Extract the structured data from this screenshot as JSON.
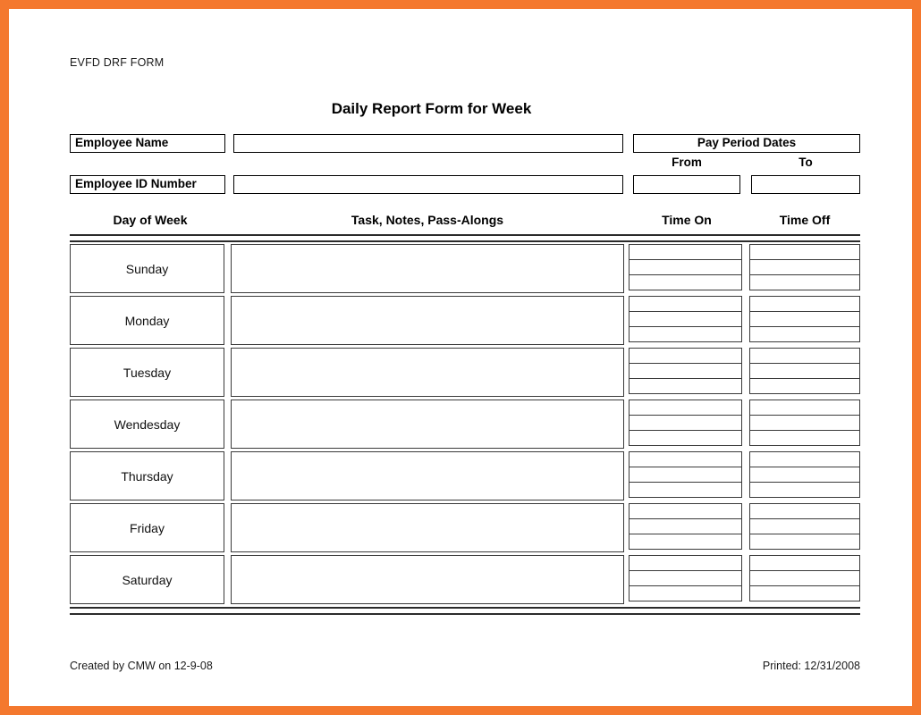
{
  "page": {
    "border_color": "#f4782e",
    "background": "#ffffff",
    "form_code": "EVFD DRF FORM",
    "title": "Daily Report Form for Week"
  },
  "employee": {
    "name_label": "Employee Name",
    "name_value": "",
    "id_label": "Employee ID Number",
    "id_value": ""
  },
  "pay_period": {
    "heading": "Pay Period Dates",
    "from_label": "From",
    "from_value": "",
    "to_label": "To",
    "to_value": ""
  },
  "table": {
    "headers": {
      "day": "Day of Week",
      "task": "Task, Notes, Pass-Alongs",
      "time_on": "Time On",
      "time_off": "Time Off"
    },
    "rows": [
      {
        "day": "Sunday",
        "task": "",
        "time_on": [
          "",
          "",
          ""
        ],
        "time_off": [
          "",
          "",
          ""
        ]
      },
      {
        "day": "Monday",
        "task": "",
        "time_on": [
          "",
          "",
          ""
        ],
        "time_off": [
          "",
          "",
          ""
        ]
      },
      {
        "day": "Tuesday",
        "task": "",
        "time_on": [
          "",
          "",
          ""
        ],
        "time_off": [
          "",
          "",
          ""
        ]
      },
      {
        "day": "Wendesday",
        "task": "",
        "time_on": [
          "",
          "",
          ""
        ],
        "time_off": [
          "",
          "",
          ""
        ]
      },
      {
        "day": "Thursday",
        "task": "",
        "time_on": [
          "",
          "",
          ""
        ],
        "time_off": [
          "",
          "",
          ""
        ]
      },
      {
        "day": "Friday",
        "task": "",
        "time_on": [
          "",
          "",
          ""
        ],
        "time_off": [
          "",
          "",
          ""
        ]
      },
      {
        "day": "Saturday",
        "task": "",
        "time_on": [
          "",
          "",
          ""
        ],
        "time_off": [
          "",
          "",
          ""
        ]
      }
    ]
  },
  "footer": {
    "created": "Created by CMW on 12-9-08",
    "printed": "Printed: 12/31/2008"
  }
}
